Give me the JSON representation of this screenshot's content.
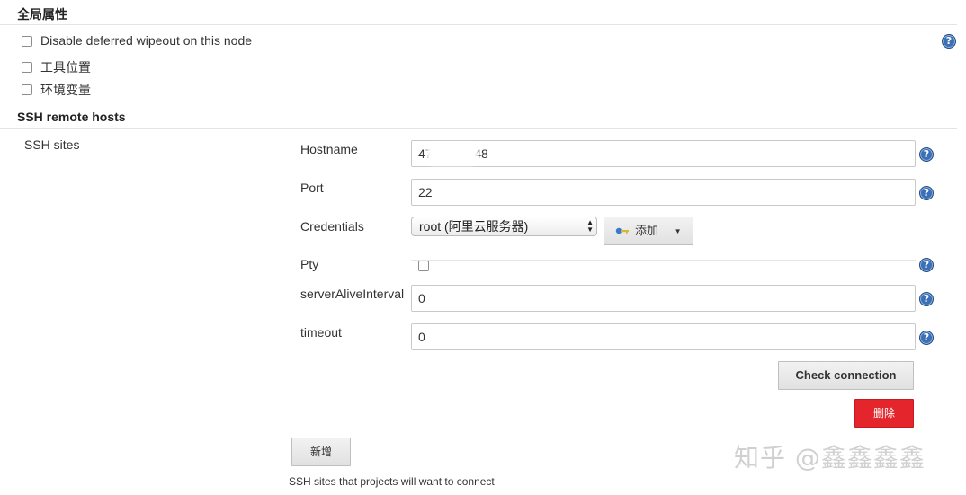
{
  "global": {
    "title": "全局属性",
    "options": [
      {
        "label": "Disable deferred wipeout on this node",
        "checked": false
      },
      {
        "label": "工具位置",
        "checked": false
      },
      {
        "label": "环境变量",
        "checked": false
      }
    ]
  },
  "ssh": {
    "section_title": "SSH remote hosts",
    "sites_label": "SSH sites",
    "fields": {
      "hostname": {
        "label": "Hostname",
        "value": "47.        .148"
      },
      "port": {
        "label": "Port",
        "value": "22"
      },
      "credentials": {
        "label": "Credentials",
        "value": "root (阿里云服务器)",
        "add_label": "添加"
      },
      "pty": {
        "label": "Pty",
        "checked": false
      },
      "server_alive_interval": {
        "label": "serverAliveInterval",
        "value": "0"
      },
      "timeout": {
        "label": "timeout",
        "value": "0"
      }
    },
    "check_connection_label": "Check connection",
    "delete_label": "删除",
    "add_label": "新增",
    "description": "SSH sites that projects will want to connect"
  },
  "help_glyph": "?",
  "watermark": "知乎 @鑫鑫鑫鑫",
  "colors": {
    "danger": "#e4262c",
    "help": "#3b6fb6"
  }
}
